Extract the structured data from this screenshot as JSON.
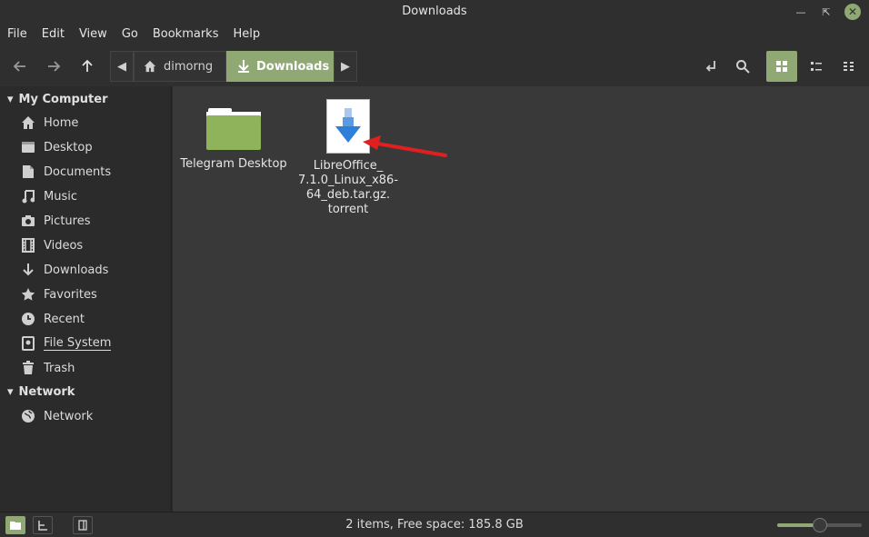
{
  "window": {
    "title": "Downloads"
  },
  "menu": [
    "File",
    "Edit",
    "View",
    "Go",
    "Bookmarks",
    "Help"
  ],
  "breadcrumb": {
    "home": "dimorng",
    "current": "Downloads"
  },
  "sidebar": {
    "my_computer": "My Computer",
    "items": [
      "Home",
      "Desktop",
      "Documents",
      "Music",
      "Pictures",
      "Videos",
      "Downloads",
      "Favorites",
      "Recent",
      "File System",
      "Trash"
    ],
    "network_head": "Network",
    "network_items": [
      "Network"
    ]
  },
  "files": [
    {
      "name": "Telegram Desktop",
      "type": "folder"
    },
    {
      "name_lines": [
        "LibreOffice_",
        "7.1.0_Linux_x86-",
        "64_deb.tar.gz.",
        "torrent"
      ],
      "type": "torrent"
    }
  ],
  "status": {
    "text": "2 items, Free space: 185.8 GB",
    "zoom": 0.5
  },
  "colors": {
    "accent": "#8fa874",
    "arrow": "#e02020"
  }
}
